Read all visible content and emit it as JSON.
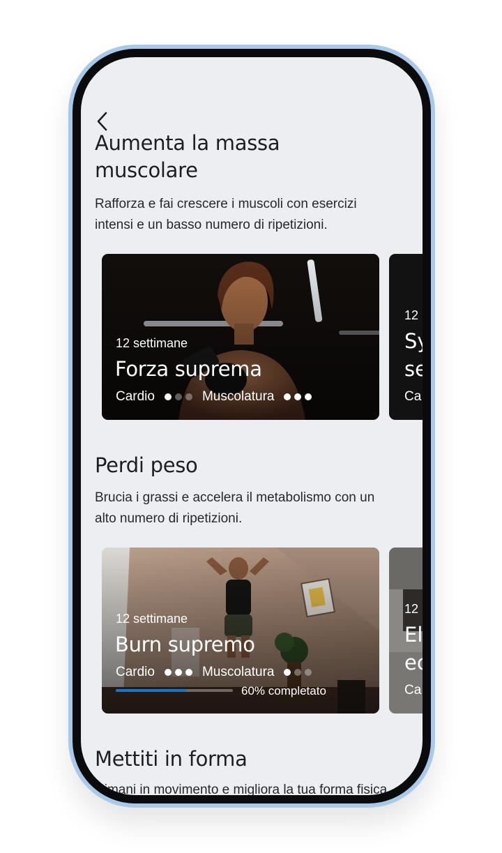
{
  "header": {
    "back_icon": "chevron-left-icon"
  },
  "sections": [
    {
      "title_line1": "Aumenta la massa",
      "title_line2": "muscolare",
      "desc_line1": "Rafforza e fai crescere i muscoli con esercizi",
      "desc_line2": "intensi e un basso numero di ripetizioni.",
      "card": {
        "weeks": "12 settimane",
        "title": "Forza suprema",
        "cardio_label": "Cardio",
        "cardio_level": "1/3",
        "muscle_label": "Muscolatura",
        "muscle_level": "3/3"
      },
      "peek": {
        "weeks": "12",
        "title_line1": "Sy",
        "title_line2": "se",
        "meta": "Ca"
      }
    },
    {
      "title_line1": "Perdi peso",
      "desc_line1": "Brucia i grassi e accelera il metabolismo con un",
      "desc_line2": "alto numero di ripetizioni.",
      "card": {
        "weeks": "12 settimane",
        "title": "Burn supremo",
        "cardio_label": "Cardio",
        "cardio_level": "3/3",
        "muscle_label": "Muscolatura",
        "muscle_level": "1/3",
        "progress_percent": 60,
        "progress_label": "60% completato"
      },
      "peek": {
        "weeks": "12",
        "title_line1": "El",
        "title_line2": "ec",
        "meta": "Ca"
      }
    },
    {
      "title_line1": "Mettiti in forma",
      "desc_line1": "Rimani in movimento e migliora la tua forma fisica"
    }
  ],
  "colors": {
    "screen_bg": "#eceef1",
    "phone_frame": "#a9c9ea",
    "progress_fill": "#1b74c7",
    "text_dark": "#1d1e22"
  }
}
